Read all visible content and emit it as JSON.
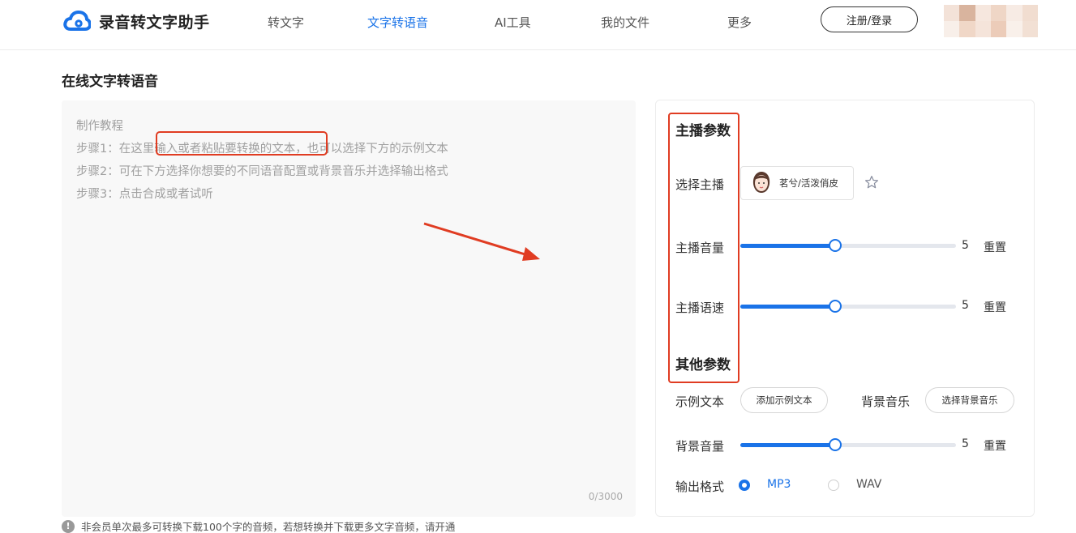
{
  "header": {
    "logo_text": "录音转文字助手",
    "nav": [
      "转文字",
      "文字转语音",
      "AI工具",
      "我的文件",
      "更多"
    ],
    "active_nav": "文字转语音",
    "login_label": "注册/登录"
  },
  "page_title": "在线文字转语音",
  "editor": {
    "placeholder": {
      "line1": "制作教程",
      "line2": "步骤1：在这里输入或者粘贴要转换的文本，也可以选择下方的示例文本",
      "line3": "步骤2：可在下方选择你想要的不同语音配置或背景音乐并选择输出格式",
      "line4": "步骤3：点击合成或者试听"
    },
    "char_count": "0/3000"
  },
  "notice": "非会员单次最多可转换下载100个字的音频，若想转换并下载更多文字音频，请开通",
  "panel": {
    "anchor_section_title": "主播参数",
    "anchor_label": "选择主播",
    "anchor_name": "茗兮/活泼俏皮",
    "volume_label": "主播音量",
    "volume_value": "5",
    "speed_label": "主播语速",
    "speed_value": "5",
    "reset_label": "重置",
    "other_section_title": "其他参数",
    "sample_label": "示例文本",
    "sample_button": "添加示例文本",
    "bgm_label": "背景音乐",
    "bgm_button": "选择背景音乐",
    "bg_volume_label": "背景音量",
    "bg_volume_value": "5",
    "format_label": "输出格式",
    "format_options": [
      "MP3",
      "WAV"
    ],
    "format_selected": "MP3"
  },
  "slider_levels": {
    "volume": 0.44,
    "speed": 0.44,
    "bg_volume": 0.44
  },
  "colors": {
    "accent": "#1a73e8",
    "highlight": "#e03c22"
  },
  "icons": {
    "logo": "cloud-logo-icon",
    "star": "star-icon",
    "info": "info-icon",
    "anchor_avatar": "female-avatar-icon"
  }
}
